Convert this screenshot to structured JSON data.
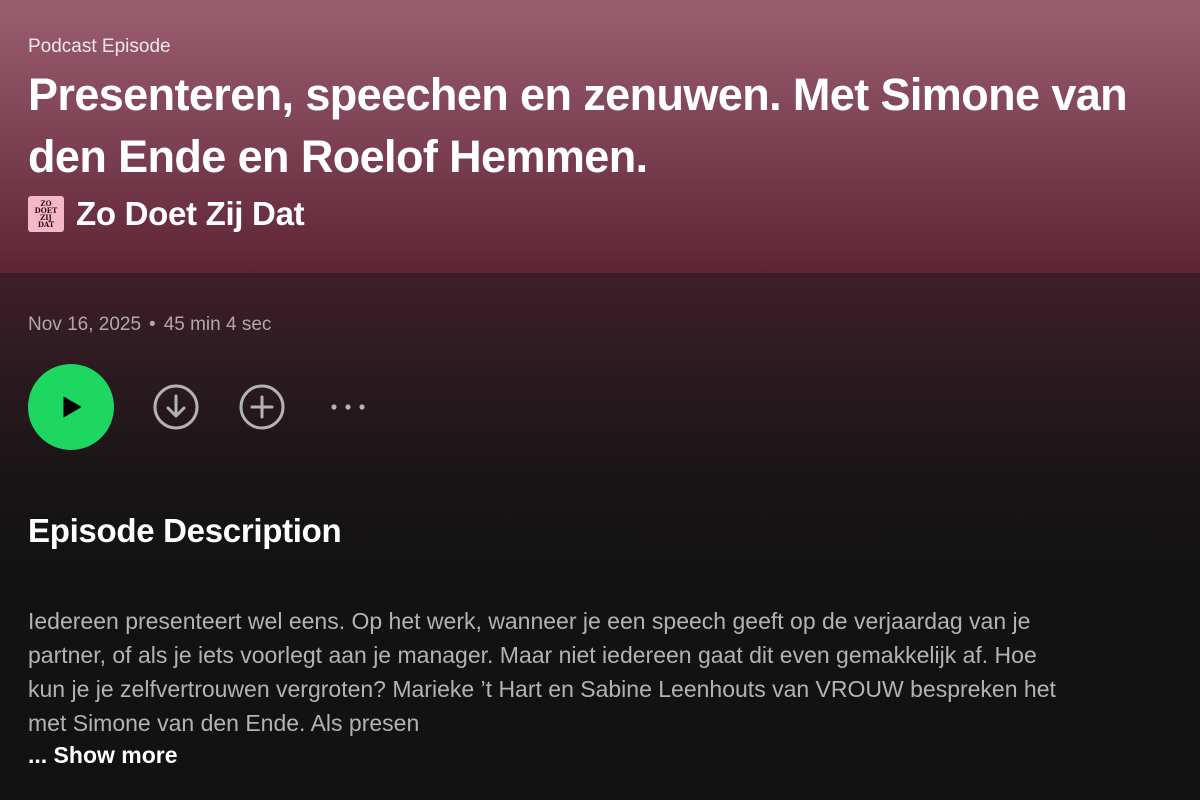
{
  "episode": {
    "type_label": "Podcast Episode",
    "title": "Presenteren, speechen en zenuwen. Met Simone van den Ende en Roelof Hemmen.",
    "date": "Nov 16, 2025",
    "separator": "•",
    "duration": "45 min 4 sec"
  },
  "show": {
    "name": "Zo Doet Zij Dat",
    "art_lines": [
      "ZO",
      "DOET",
      "ZIJ",
      "DAT"
    ]
  },
  "actions": {
    "play_icon": "play-icon",
    "download_icon": "download-icon",
    "add_icon": "add-icon",
    "more_icon": "more-options-icon"
  },
  "description": {
    "heading": "Episode Description",
    "text": "Iedereen presenteert wel eens. Op het werk, wanneer je een speech geeft op de verjaardag van je partner, of als je iets voorlegt aan je manager. Maar niet iedereen gaat dit even gemakkelijk af. Hoe kun je je zelfvertrouwen vergroten? Marieke ’t Hart en Sabine Leenhouts van VROUW bespreken het met Simone van den Ende. Als presen",
    "show_more": "... Show more"
  },
  "colors": {
    "accent": "#1ed760",
    "hero_top": "#9a5e70",
    "hero_bottom": "#5e2436",
    "background": "#121212"
  }
}
